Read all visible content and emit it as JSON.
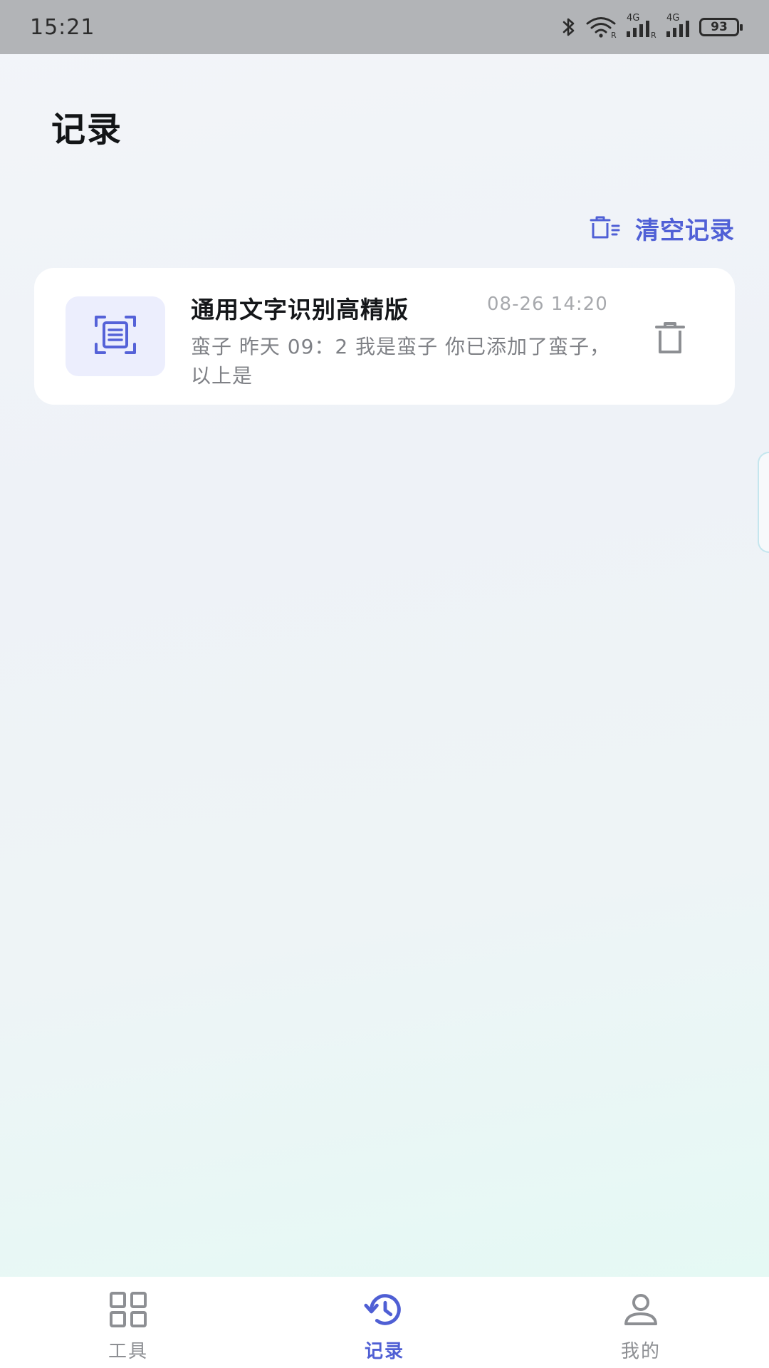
{
  "status_bar": {
    "time": "15:21",
    "battery": "93",
    "network_labels": [
      "4G",
      "4G"
    ],
    "icons": [
      "bluetooth-icon",
      "wifi-icon",
      "signal-icon",
      "signal-icon",
      "battery-icon"
    ]
  },
  "page": {
    "title": "记录",
    "clear_label": "清空记录"
  },
  "records": [
    {
      "title": "通用文字识别高精版",
      "time": "08-26 14:20",
      "preview": "蛮子 昨天 09：2 我是蛮子 你已添加了蛮子，以上是",
      "icon": "scan-text-icon"
    }
  ],
  "bottom_nav": {
    "items": [
      {
        "label": "工具",
        "icon": "grid-icon",
        "active": false
      },
      {
        "label": "记录",
        "icon": "history-icon",
        "active": true
      },
      {
        "label": "我的",
        "icon": "user-icon",
        "active": false
      }
    ]
  },
  "colors": {
    "accent": "#5060d6",
    "status_bar": "#b2b4b7",
    "card": "#ffffff",
    "icon_bg": "#eceefd",
    "muted_text": "#8d8f93"
  }
}
